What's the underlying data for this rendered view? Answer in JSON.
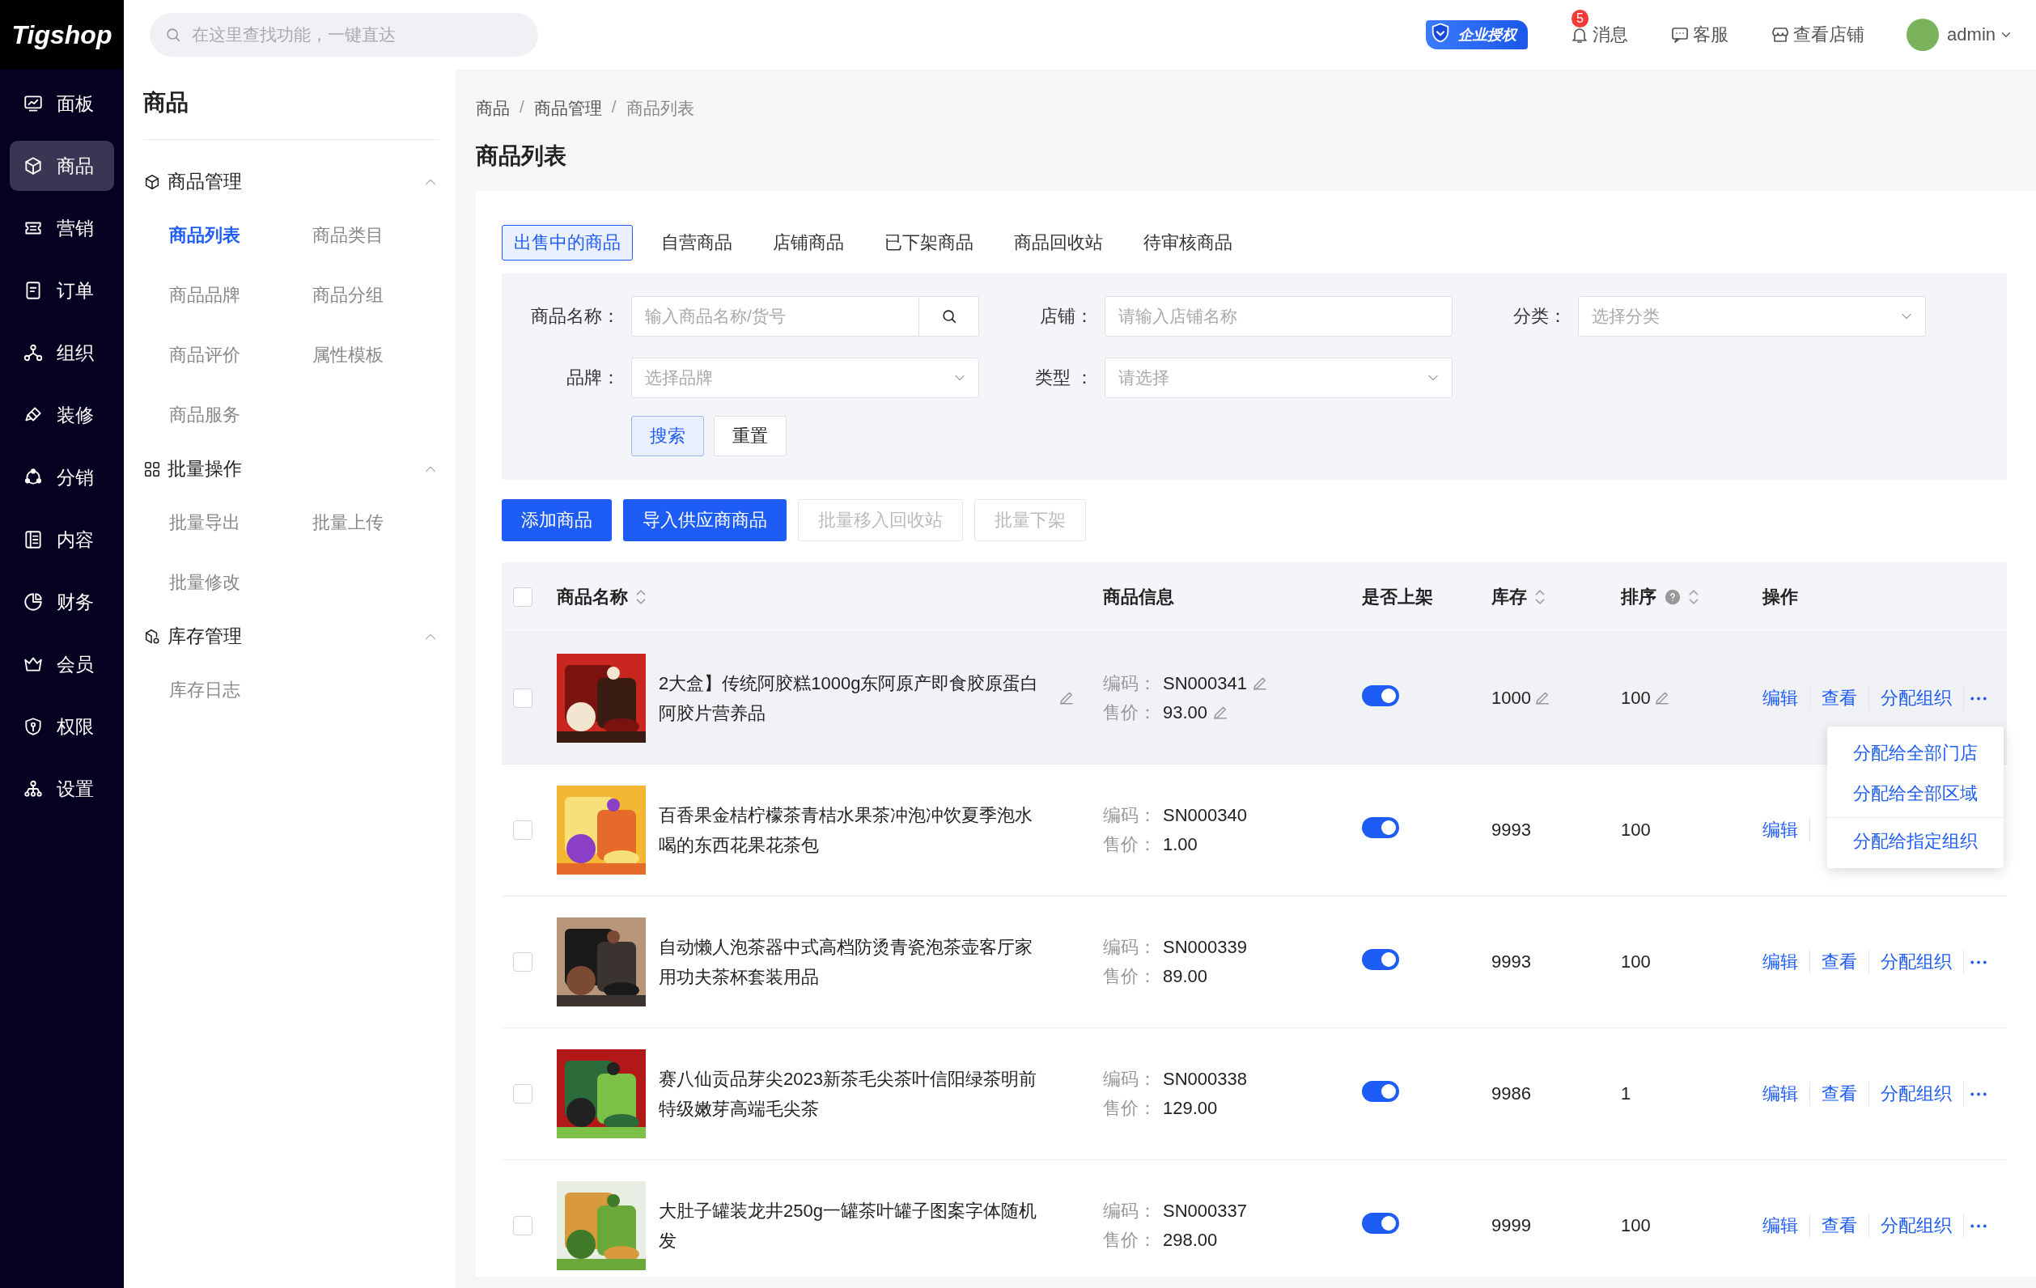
{
  "logo": "Tigshop",
  "search": {
    "placeholder": "在这里查找功能，一键直达"
  },
  "header": {
    "license_badge": "企业授权",
    "notifications": {
      "label": "消息",
      "count": "5"
    },
    "links": [
      "客服",
      "查看店铺"
    ],
    "user": "admin"
  },
  "nav": [
    {
      "label": "面板",
      "selected": false
    },
    {
      "label": "商品",
      "selected": true
    },
    {
      "label": "营销",
      "selected": false
    },
    {
      "label": "订单",
      "selected": false
    },
    {
      "label": "组织",
      "selected": false
    },
    {
      "label": "装修",
      "selected": false
    },
    {
      "label": "分销",
      "selected": false
    },
    {
      "label": "内容",
      "selected": false
    },
    {
      "label": "财务",
      "selected": false
    },
    {
      "label": "会员",
      "selected": false
    },
    {
      "label": "权限",
      "selected": false
    },
    {
      "label": "设置",
      "selected": false
    }
  ],
  "submenu": {
    "title": "商品",
    "groups": [
      {
        "title": "商品管理",
        "expanded": true,
        "items": [
          {
            "label": "商品列表",
            "selected": true
          },
          {
            "label": "商品类目",
            "selected": false
          },
          {
            "label": "商品品牌",
            "selected": false
          },
          {
            "label": "商品分组",
            "selected": false
          },
          {
            "label": "商品评价",
            "selected": false
          },
          {
            "label": "属性模板",
            "selected": false
          },
          {
            "label": "商品服务",
            "selected": false
          }
        ]
      },
      {
        "title": "批量操作",
        "expanded": true,
        "items": [
          {
            "label": "批量导出",
            "selected": false
          },
          {
            "label": "批量上传",
            "selected": false
          },
          {
            "label": "批量修改",
            "selected": false
          }
        ]
      },
      {
        "title": "库存管理",
        "expanded": true,
        "items": [
          {
            "label": "库存日志",
            "selected": false
          }
        ]
      }
    ]
  },
  "breadcrumb": [
    {
      "text": "商品",
      "kind": "link"
    },
    {
      "text": "/",
      "kind": "separator"
    },
    {
      "text": "商品管理",
      "kind": "link"
    },
    {
      "text": "/",
      "kind": "separator"
    },
    {
      "text": "商品列表",
      "kind": "current"
    }
  ],
  "page_title": "商品列表",
  "tabs": [
    {
      "label": "出售中的商品",
      "selected": true
    },
    {
      "label": "自营商品",
      "selected": false
    },
    {
      "label": "店铺商品",
      "selected": false
    },
    {
      "label": "已下架商品",
      "selected": false
    },
    {
      "label": "商品回收站",
      "selected": false
    },
    {
      "label": "待审核商品",
      "selected": false
    }
  ],
  "filters": [
    {
      "label": "商品名称：",
      "kind": "search",
      "placeholder": "输入商品名称/货号"
    },
    {
      "label": "店铺：",
      "kind": "text",
      "placeholder": "请输入店铺名称"
    },
    {
      "label": "分类：",
      "kind": "select",
      "placeholder": "选择分类"
    },
    {
      "label": "品牌：",
      "kind": "select",
      "placeholder": "选择品牌"
    },
    {
      "label": "类型 ：",
      "kind": "select",
      "placeholder": "请选择"
    }
  ],
  "filter_buttons": [
    {
      "label": "搜索",
      "kind": "primary"
    },
    {
      "label": "重置",
      "kind": "default"
    }
  ],
  "actions": [
    {
      "label": "添加商品",
      "disabled": false
    },
    {
      "label": "导入供应商商品",
      "disabled": false
    },
    {
      "label": "批量移入回收站",
      "disabled": true
    },
    {
      "label": "批量下架",
      "disabled": true
    }
  ],
  "table": {
    "select_all": {
      "checked": false
    },
    "columns": [
      {
        "label": "商品名称",
        "sortable": true,
        "help": false
      },
      {
        "label": "商品信息",
        "sortable": false,
        "help": false
      },
      {
        "label": "是否上架",
        "sortable": false,
        "help": false
      },
      {
        "label": "库存",
        "sortable": true,
        "help": false
      },
      {
        "label": "排序",
        "sortable": true,
        "help": true
      },
      {
        "label": "操作",
        "sortable": false,
        "help": false
      }
    ],
    "rows": [
      {
        "checked": false,
        "highlighted": true,
        "editable": true,
        "name": "2大盒】传统阿胶糕1000g东阿原产即食胶原蛋白阿胶片营养品",
        "code_label": "编码：",
        "code": "SN000341",
        "price_label": "售价：",
        "price": "93.00",
        "on_sale": true,
        "stock": "1000",
        "sort": "100",
        "actions": [
          "编辑",
          "查看",
          "分配组织"
        ],
        "more": true
      },
      {
        "checked": false,
        "highlighted": false,
        "editable": false,
        "name": "百香果金桔柠檬茶青桔水果茶冲泡冲饮夏季泡水喝的东西花果花茶包",
        "code_label": "编码：",
        "code": "SN000340",
        "price_label": "售价：",
        "price": "1.00",
        "on_sale": true,
        "stock": "9993",
        "sort": "100",
        "actions": [
          "编辑"
        ],
        "more": false
      },
      {
        "checked": false,
        "highlighted": false,
        "editable": false,
        "name": "自动懒人泡茶器中式高档防烫青瓷泡茶壶客厅家用功夫茶杯套装用品",
        "code_label": "编码：",
        "code": "SN000339",
        "price_label": "售价：",
        "price": "89.00",
        "on_sale": true,
        "stock": "9993",
        "sort": "100",
        "actions": [
          "编辑",
          "查看",
          "分配组织"
        ],
        "more": true
      },
      {
        "checked": false,
        "highlighted": false,
        "editable": false,
        "name": "赛八仙贡品芽尖2023新茶毛尖茶叶信阳绿茶明前特级嫩芽高端毛尖茶",
        "code_label": "编码：",
        "code": "SN000338",
        "price_label": "售价：",
        "price": "129.00",
        "on_sale": true,
        "stock": "9986",
        "sort": "1",
        "actions": [
          "编辑",
          "查看",
          "分配组织"
        ],
        "more": true
      },
      {
        "checked": false,
        "highlighted": false,
        "editable": false,
        "name": "大肚子罐装龙井250g一罐茶叶罐子图案字体随机发",
        "code_label": "编码：",
        "code": "SN000337",
        "price_label": "售价：",
        "price": "298.00",
        "on_sale": true,
        "stock": "9999",
        "sort": "100",
        "actions": [
          "编辑",
          "查看",
          "分配组织"
        ],
        "more": true
      }
    ]
  },
  "dropdown": {
    "items": [
      "分配给全部门店",
      "分配给全部区域",
      "分配给指定组织"
    ]
  }
}
